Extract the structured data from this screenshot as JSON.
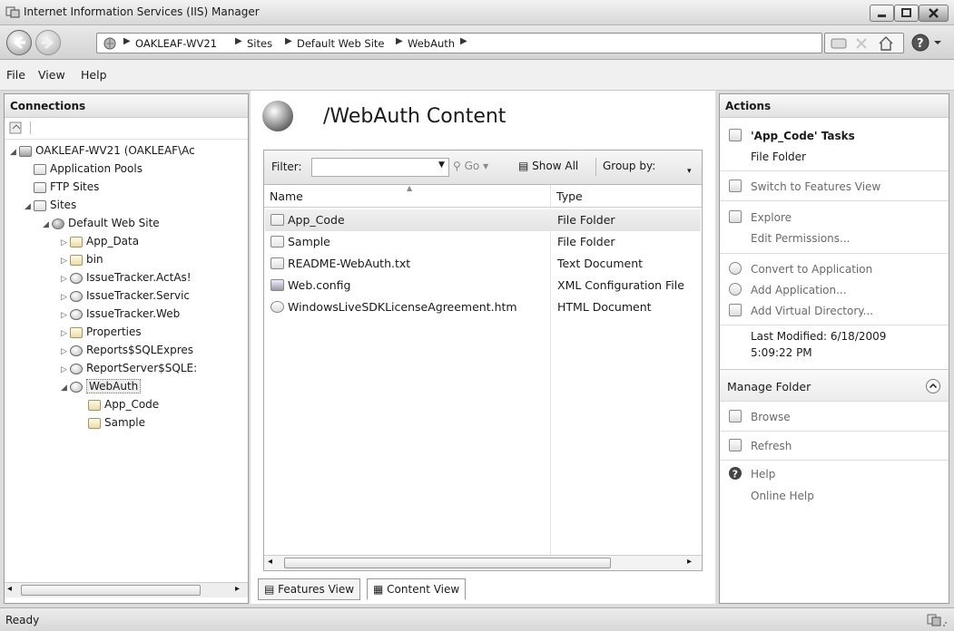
{
  "window": {
    "title": "Internet Information Services (IIS) Manager",
    "buttons": [
      "minimize",
      "maximize",
      "close"
    ]
  },
  "address": {
    "crumbs": [
      "OAKLEAF-WV21",
      "Sites",
      "Default Web Site",
      "WebAuth"
    ]
  },
  "menu": {
    "items": [
      "File",
      "View",
      "Help"
    ]
  },
  "connections": {
    "title": "Connections",
    "tree": [
      {
        "label": "OAKLEAF-WV21 (OAKLEAF\\Ac",
        "level": 0,
        "icon": "server-icon",
        "toggle": "expanded"
      },
      {
        "label": "Application Pools",
        "level": 1,
        "icon": "app-pools-icon",
        "toggle": "none"
      },
      {
        "label": "FTP Sites",
        "level": 1,
        "icon": "ftp-icon",
        "toggle": "none"
      },
      {
        "label": "Sites",
        "level": 1,
        "icon": "sites-icon",
        "toggle": "expanded"
      },
      {
        "label": "Default Web Site",
        "level": 2,
        "icon": "globe-icon",
        "toggle": "expanded"
      },
      {
        "label": "App_Data",
        "level": 3,
        "icon": "folder-icon",
        "toggle": "collapsed"
      },
      {
        "label": "bin",
        "level": 3,
        "icon": "folder-icon",
        "toggle": "collapsed"
      },
      {
        "label": "IssueTracker.ActAs!",
        "level": 3,
        "icon": "application-icon",
        "toggle": "collapsed"
      },
      {
        "label": "IssueTracker.Servic",
        "level": 3,
        "icon": "application-icon",
        "toggle": "collapsed"
      },
      {
        "label": "IssueTracker.Web",
        "level": 3,
        "icon": "application-icon",
        "toggle": "collapsed"
      },
      {
        "label": "Properties",
        "level": 3,
        "icon": "folder-icon",
        "toggle": "collapsed"
      },
      {
        "label": "Reports$SQLExpres",
        "level": 3,
        "icon": "application-icon",
        "toggle": "collapsed"
      },
      {
        "label": "ReportServer$SQLE:",
        "level": 3,
        "icon": "application-icon",
        "toggle": "collapsed"
      },
      {
        "label": "WebAuth",
        "level": 3,
        "icon": "application-icon",
        "toggle": "expanded",
        "selected": true
      },
      {
        "label": "App_Code",
        "level": 4,
        "icon": "folder-icon",
        "toggle": "none"
      },
      {
        "label": "Sample",
        "level": 4,
        "icon": "folder-icon",
        "toggle": "none"
      }
    ]
  },
  "content": {
    "title": "/WebAuth Content",
    "filter_label": "Filter:",
    "go_label": "Go",
    "show_all_label": "Show All",
    "group_by_label": "Group by:",
    "columns": [
      "Name",
      "Type"
    ],
    "rows": [
      {
        "name": "App_Code",
        "type": "File Folder",
        "icon": "folder-icon",
        "selected": true
      },
      {
        "name": "Sample",
        "type": "File Folder",
        "icon": "folder-icon"
      },
      {
        "name": "README-WebAuth.txt",
        "type": "Text Document",
        "icon": "text-file-icon"
      },
      {
        "name": "Web.config",
        "type": "XML Configuration File",
        "icon": "config-file-icon"
      },
      {
        "name": "WindowsLiveSDKLicenseAgreement.htm",
        "type": "HTML Document",
        "icon": "html-file-icon"
      }
    ],
    "tabs": {
      "features": "Features View",
      "content": "Content View"
    }
  },
  "actions": {
    "title": "Actions",
    "tasks_title": "'App_Code' Tasks",
    "tasks_subtitle": "File Folder",
    "switch_features": "Switch to Features View",
    "explore": "Explore",
    "edit_permissions": "Edit Permissions...",
    "convert_app": "Convert to Application",
    "add_app": "Add Application...",
    "add_vdir": "Add Virtual Directory...",
    "last_modified_1": "Last Modified: 6/18/2009",
    "last_modified_2": "5:09:22 PM",
    "manage_folder": "Manage Folder",
    "browse": "Browse",
    "refresh": "Refresh",
    "help": "Help",
    "online_help": "Online Help"
  },
  "status": {
    "text": "Ready"
  }
}
